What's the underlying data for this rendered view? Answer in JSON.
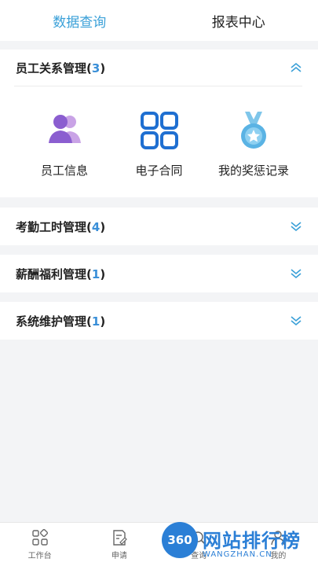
{
  "top_tabs": [
    {
      "label": "数据查询",
      "active": true
    },
    {
      "label": "报表中心",
      "active": false
    }
  ],
  "sections": [
    {
      "title": "员工关系管理",
      "count": "3",
      "expanded": true,
      "items": [
        {
          "label": "员工信息",
          "icon": "employees-icon"
        },
        {
          "label": "电子合同",
          "icon": "grid-apps-icon"
        },
        {
          "label": "我的奖惩记录",
          "icon": "medal-icon"
        }
      ]
    },
    {
      "title": "考勤工时管理",
      "count": "4",
      "expanded": false
    },
    {
      "title": "薪酬福利管理",
      "count": "1",
      "expanded": false
    },
    {
      "title": "系统维护管理",
      "count": "1",
      "expanded": false
    }
  ],
  "bottom_nav": [
    {
      "label": "工作台",
      "icon": "workbench-icon"
    },
    {
      "label": "申请",
      "icon": "apply-icon"
    },
    {
      "label": "查询",
      "icon": "query-icon"
    },
    {
      "label": "我的",
      "icon": "me-icon"
    }
  ],
  "watermark": {
    "badge": "360",
    "big": "网站排行榜",
    "small": "WANGZHAN.CN"
  },
  "colors": {
    "accent": "#3aa0d8",
    "count": "#3a8fd8",
    "background": "#f3f4f6"
  }
}
